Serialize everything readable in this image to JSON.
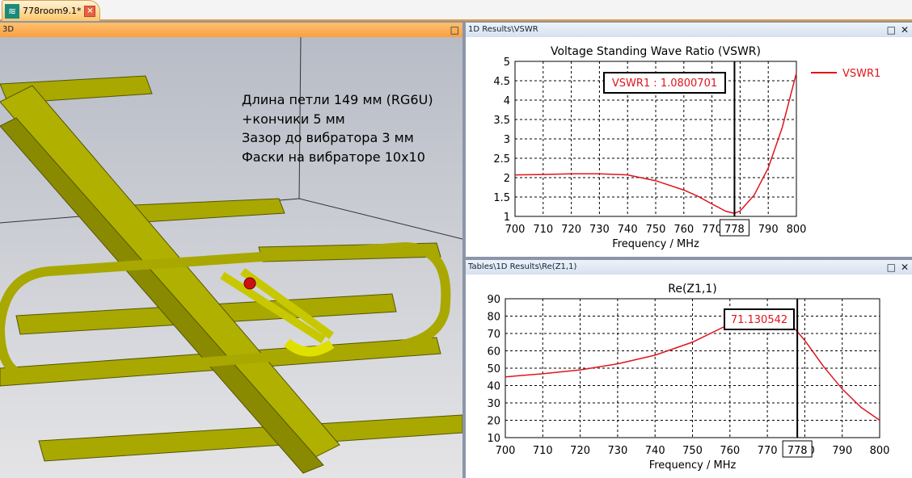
{
  "tab": {
    "title": "778room9.1*",
    "icon": "cst-wave-icon"
  },
  "panel3d": {
    "title": "3D",
    "notes": [
      "Длина петли 149 мм   (RG6U)",
      "+кончики 5 мм",
      "Зазор до вибратора 3 мм",
      "Фаски на вибраторе 10x10"
    ]
  },
  "vswr_panel": {
    "title": "1D Results\\VSWR"
  },
  "re_panel": {
    "title": "Tables\\1D Results\\Re(Z1,1)"
  },
  "chart_data": [
    {
      "type": "line",
      "title": "Voltage Standing Wave Ratio (VSWR)",
      "xlabel": "Frequency / MHz",
      "ylabel": "",
      "xlim": [
        700,
        800
      ],
      "ylim": [
        1,
        5
      ],
      "xticks": [
        700,
        710,
        720,
        730,
        740,
        750,
        760,
        770,
        780,
        790,
        800
      ],
      "yticks": [
        1,
        1.5,
        2,
        2.5,
        3,
        3.5,
        4,
        4.5,
        5
      ],
      "grid": true,
      "legend": "right",
      "marker_x": 778,
      "marker_label": "778",
      "annotation": "VSWR1 : 1.0800701",
      "series": [
        {
          "name": "VSWR1",
          "color": "#e0141e",
          "x": [
            700,
            710,
            720,
            730,
            740,
            750,
            760,
            765,
            770,
            775,
            778,
            780,
            785,
            790,
            795,
            800
          ],
          "y": [
            2.07,
            2.08,
            2.1,
            2.1,
            2.07,
            1.92,
            1.68,
            1.52,
            1.32,
            1.13,
            1.08,
            1.14,
            1.55,
            2.25,
            3.3,
            4.7
          ]
        }
      ]
    },
    {
      "type": "line",
      "title": "Re(Z1,1)",
      "xlabel": "Frequency / MHz",
      "ylabel": "",
      "xlim": [
        700,
        800
      ],
      "ylim": [
        10,
        90
      ],
      "xticks": [
        700,
        710,
        720,
        730,
        740,
        750,
        760,
        770,
        780,
        790,
        800
      ],
      "yticks": [
        10,
        20,
        30,
        40,
        50,
        60,
        70,
        80,
        90
      ],
      "grid": true,
      "legend": "none",
      "marker_x": 778,
      "marker_label": "778",
      "annotation": "71.130542",
      "series": [
        {
          "name": "Re(Z1,1)",
          "color": "#e0141e",
          "x": [
            700,
            710,
            720,
            730,
            740,
            750,
            760,
            765,
            770,
            775,
            778,
            780,
            785,
            790,
            795,
            800
          ],
          "y": [
            45,
            46.8,
            49,
            52.5,
            57.5,
            65,
            75.5,
            80.5,
            83,
            78,
            71.1,
            66,
            51,
            38,
            27.5,
            20
          ]
        }
      ]
    }
  ]
}
